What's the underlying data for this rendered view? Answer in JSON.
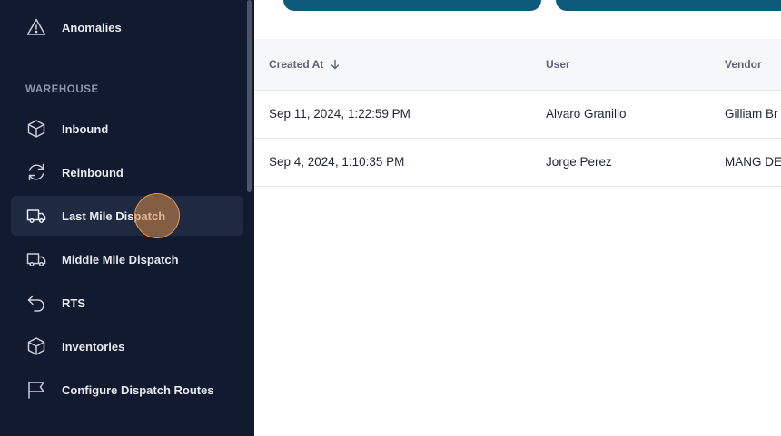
{
  "sidebar": {
    "items_top": [
      {
        "label": "Anomalies",
        "icon": "warning-icon"
      }
    ],
    "section_label": "WAREHOUSE",
    "items": [
      {
        "label": "Inbound",
        "icon": "box-icon"
      },
      {
        "label": "Reinbound",
        "icon": "refresh-icon"
      },
      {
        "label": "Last Mile Dispatch",
        "icon": "truck-icon",
        "active": true
      },
      {
        "label": "Middle Mile Dispatch",
        "icon": "truck-icon"
      },
      {
        "label": "RTS",
        "icon": "return-arrow-icon"
      },
      {
        "label": "Inventories",
        "icon": "box-icon"
      },
      {
        "label": "Configure Dispatch Routes",
        "icon": "flag-icon"
      }
    ]
  },
  "table": {
    "columns": [
      {
        "label": "Created At",
        "sort": "descending"
      },
      {
        "label": "User"
      },
      {
        "label": "Vendor"
      }
    ],
    "rows": [
      {
        "created_at": "Sep 11, 2024, 1:22:59 PM",
        "user": "Alvaro Granillo",
        "vendor": "Gilliam Br"
      },
      {
        "created_at": "Sep 4, 2024, 1:10:35 PM",
        "user": "Jorge Perez",
        "vendor": "MANG DE"
      }
    ]
  },
  "colors": {
    "sidebar_bg": "#111a2e",
    "active_item_bg": "#1f2a40",
    "button_bg": "#0e5a7a",
    "header_bg": "#f6f7f9"
  }
}
